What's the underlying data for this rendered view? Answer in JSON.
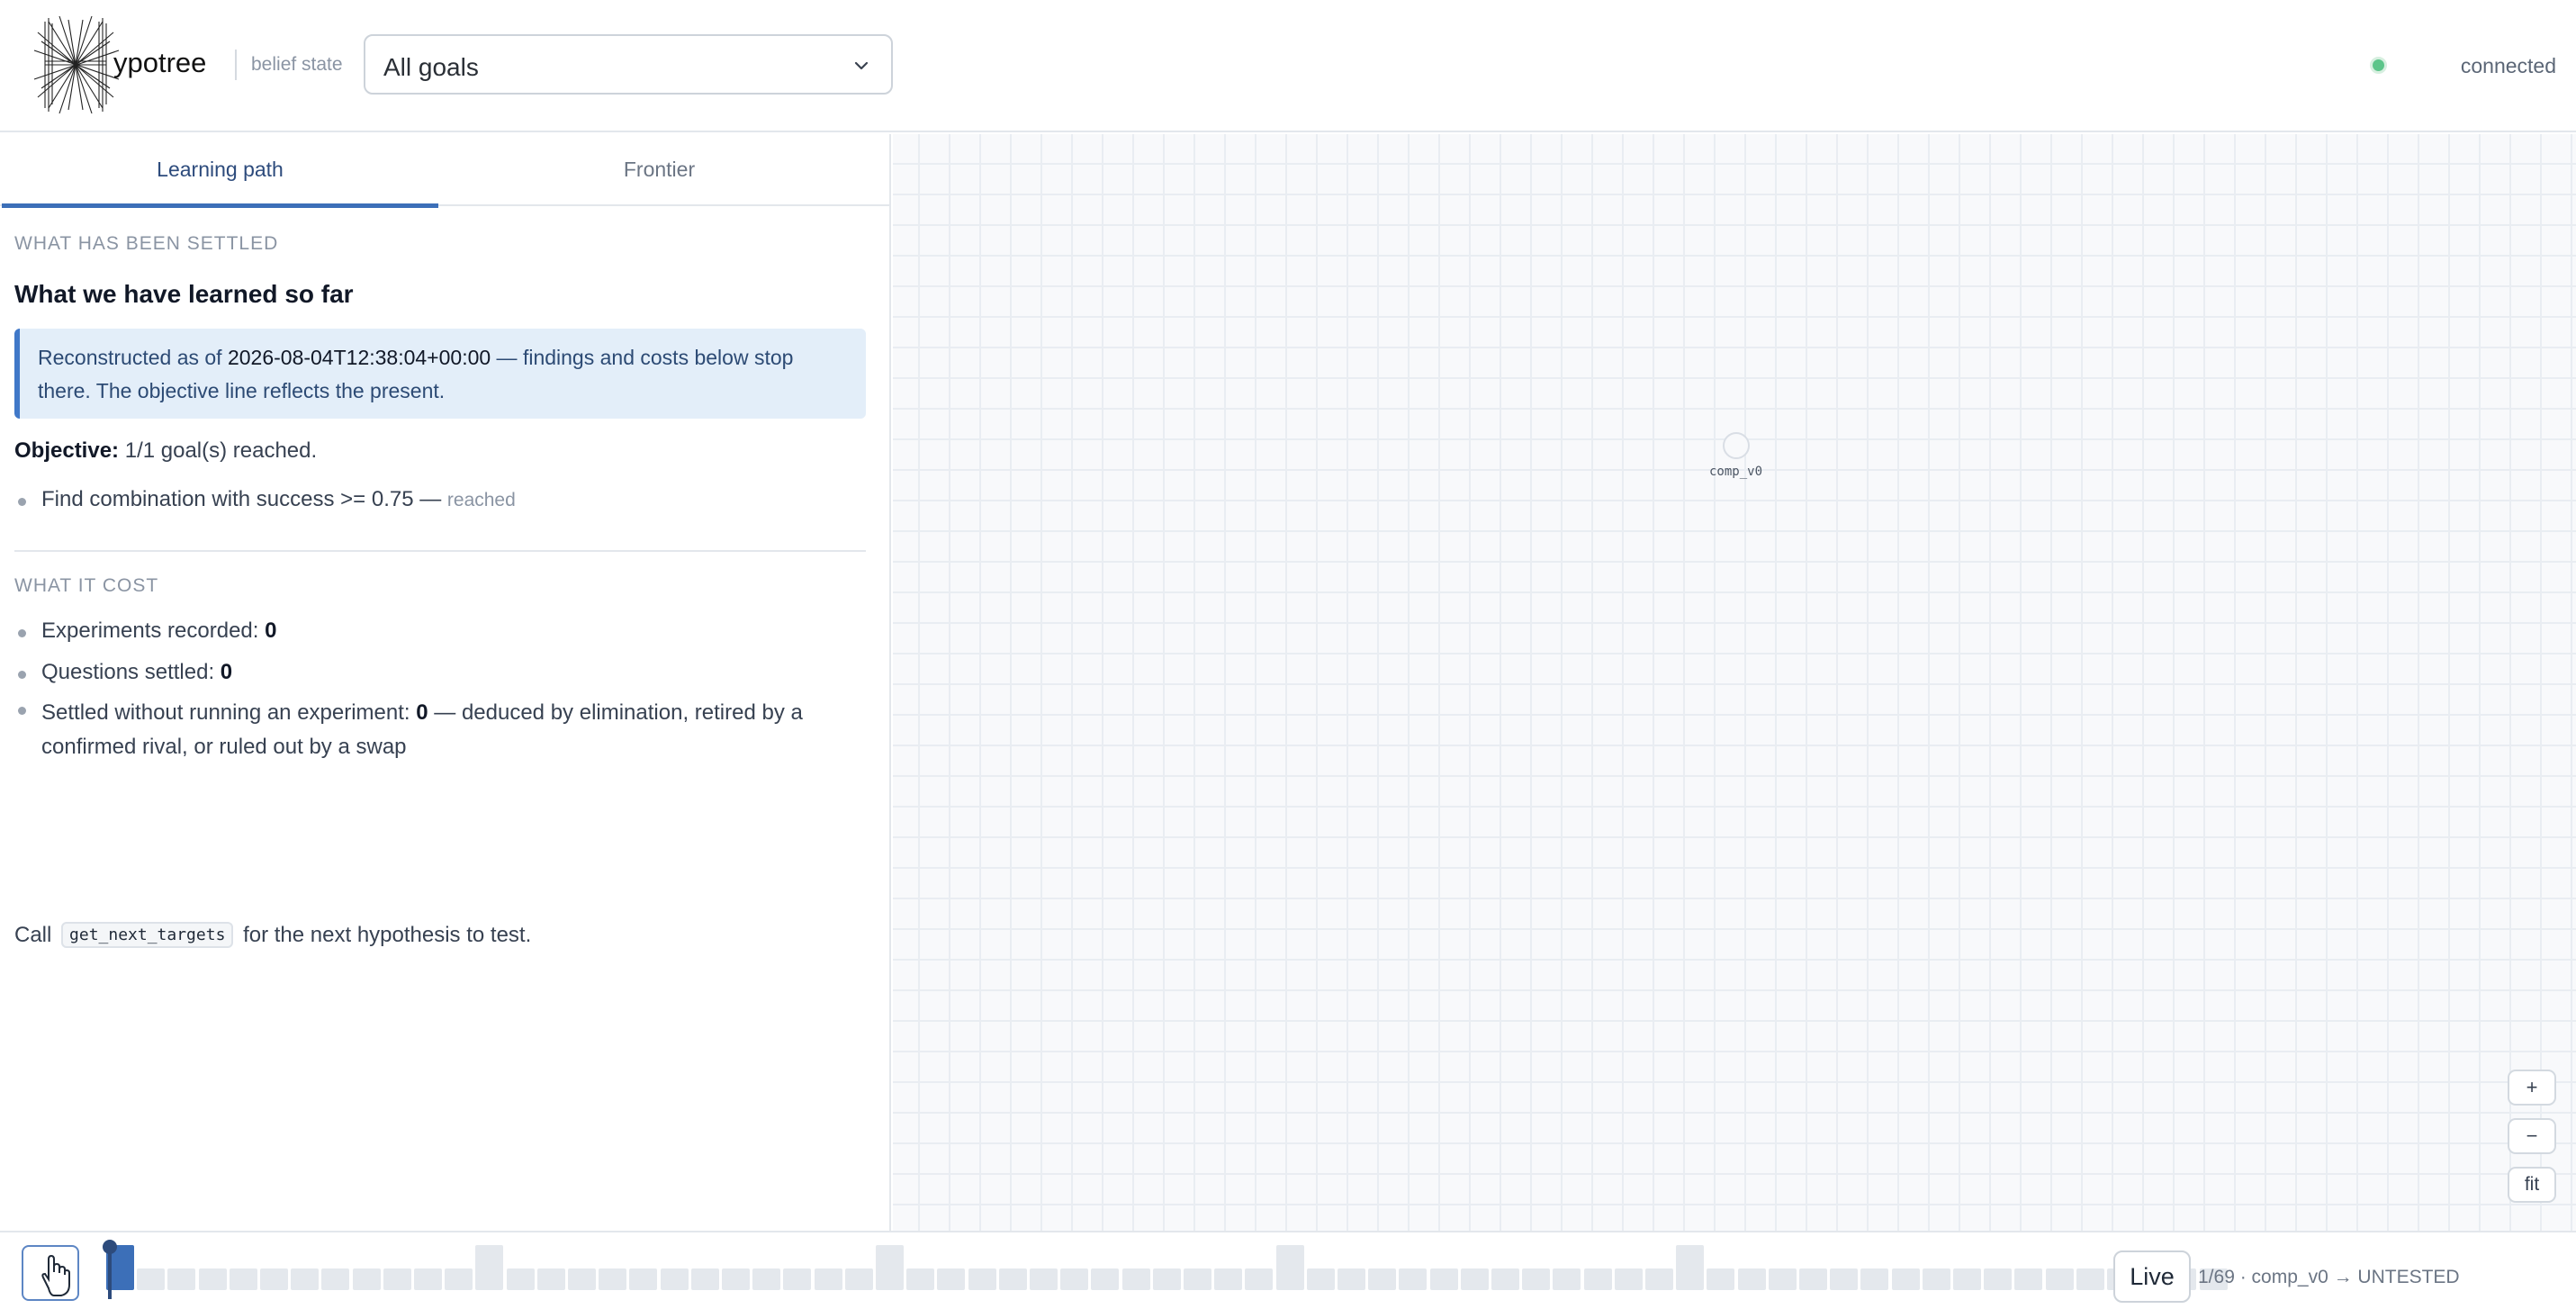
{
  "header": {
    "logo_text": "ypotree",
    "subtitle": "belief state",
    "goal_select": {
      "value": "All goals"
    },
    "connection": {
      "label": "connected",
      "color": "#5cc58a"
    }
  },
  "tabs": [
    {
      "label": "Learning path",
      "active": true
    },
    {
      "label": "Frontier",
      "active": false
    }
  ],
  "learning": {
    "section1": "WHAT HAS BEEN SETTLED",
    "heading": "What we have learned so far",
    "callout": {
      "prefix": "Reconstructed as of ",
      "timestamp": "2026-08-04T12:38:04+00:00",
      "suffix": " — findings and costs below stop there. The objective line reflects the present."
    },
    "objective": {
      "label": "Objective:",
      "value": " 1/1 goal(s) reached."
    },
    "goals": [
      {
        "text": "Find combination with success >= 0.75 — ",
        "status": "reached"
      }
    ],
    "section2": "WHAT IT COST",
    "costs": [
      {
        "label": "Experiments recorded: ",
        "value": "0",
        "suffix": ""
      },
      {
        "label": "Questions settled: ",
        "value": "0",
        "suffix": ""
      },
      {
        "label": "Settled without running an experiment: ",
        "value": "0",
        "suffix": " — deduced by elimination, retired by a confirmed rival, or ruled out by a swap"
      }
    ],
    "call": {
      "prefix": "Call ",
      "code": "get_next_targets",
      "suffix": " for the next hypothesis to test."
    }
  },
  "canvas": {
    "node_label": "comp_v0",
    "zoom_in": "+",
    "zoom_out": "−",
    "fit": "fit"
  },
  "timeline": {
    "live_label": "Live",
    "status": "1/69 · comp_v0 → UNTESTED",
    "total_steps": 69,
    "current_step": 1,
    "tall_steps": [
      1,
      13,
      26,
      39,
      52
    ],
    "accent": "#3c6fb8"
  }
}
